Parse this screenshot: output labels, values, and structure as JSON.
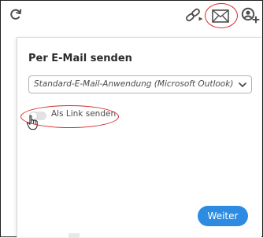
{
  "toolbar": {
    "icons": [
      "refresh-icon",
      "share-link-icon",
      "email-icon",
      "add-user-icon"
    ]
  },
  "panel": {
    "title": "Per E-Mail senden",
    "client_select": {
      "value": "Standard-E-Mail-Anwendung (Microsoft Outlook)",
      "icon": "chevron-down-icon"
    },
    "link_toggle": {
      "label": "Als Link senden",
      "on": false
    },
    "primary_button": "Weiter"
  },
  "colors": {
    "accent": "#2d8ce2",
    "annotation": "#d9262a",
    "icon": "#4d4d4d",
    "border": "#1f1f1f"
  }
}
